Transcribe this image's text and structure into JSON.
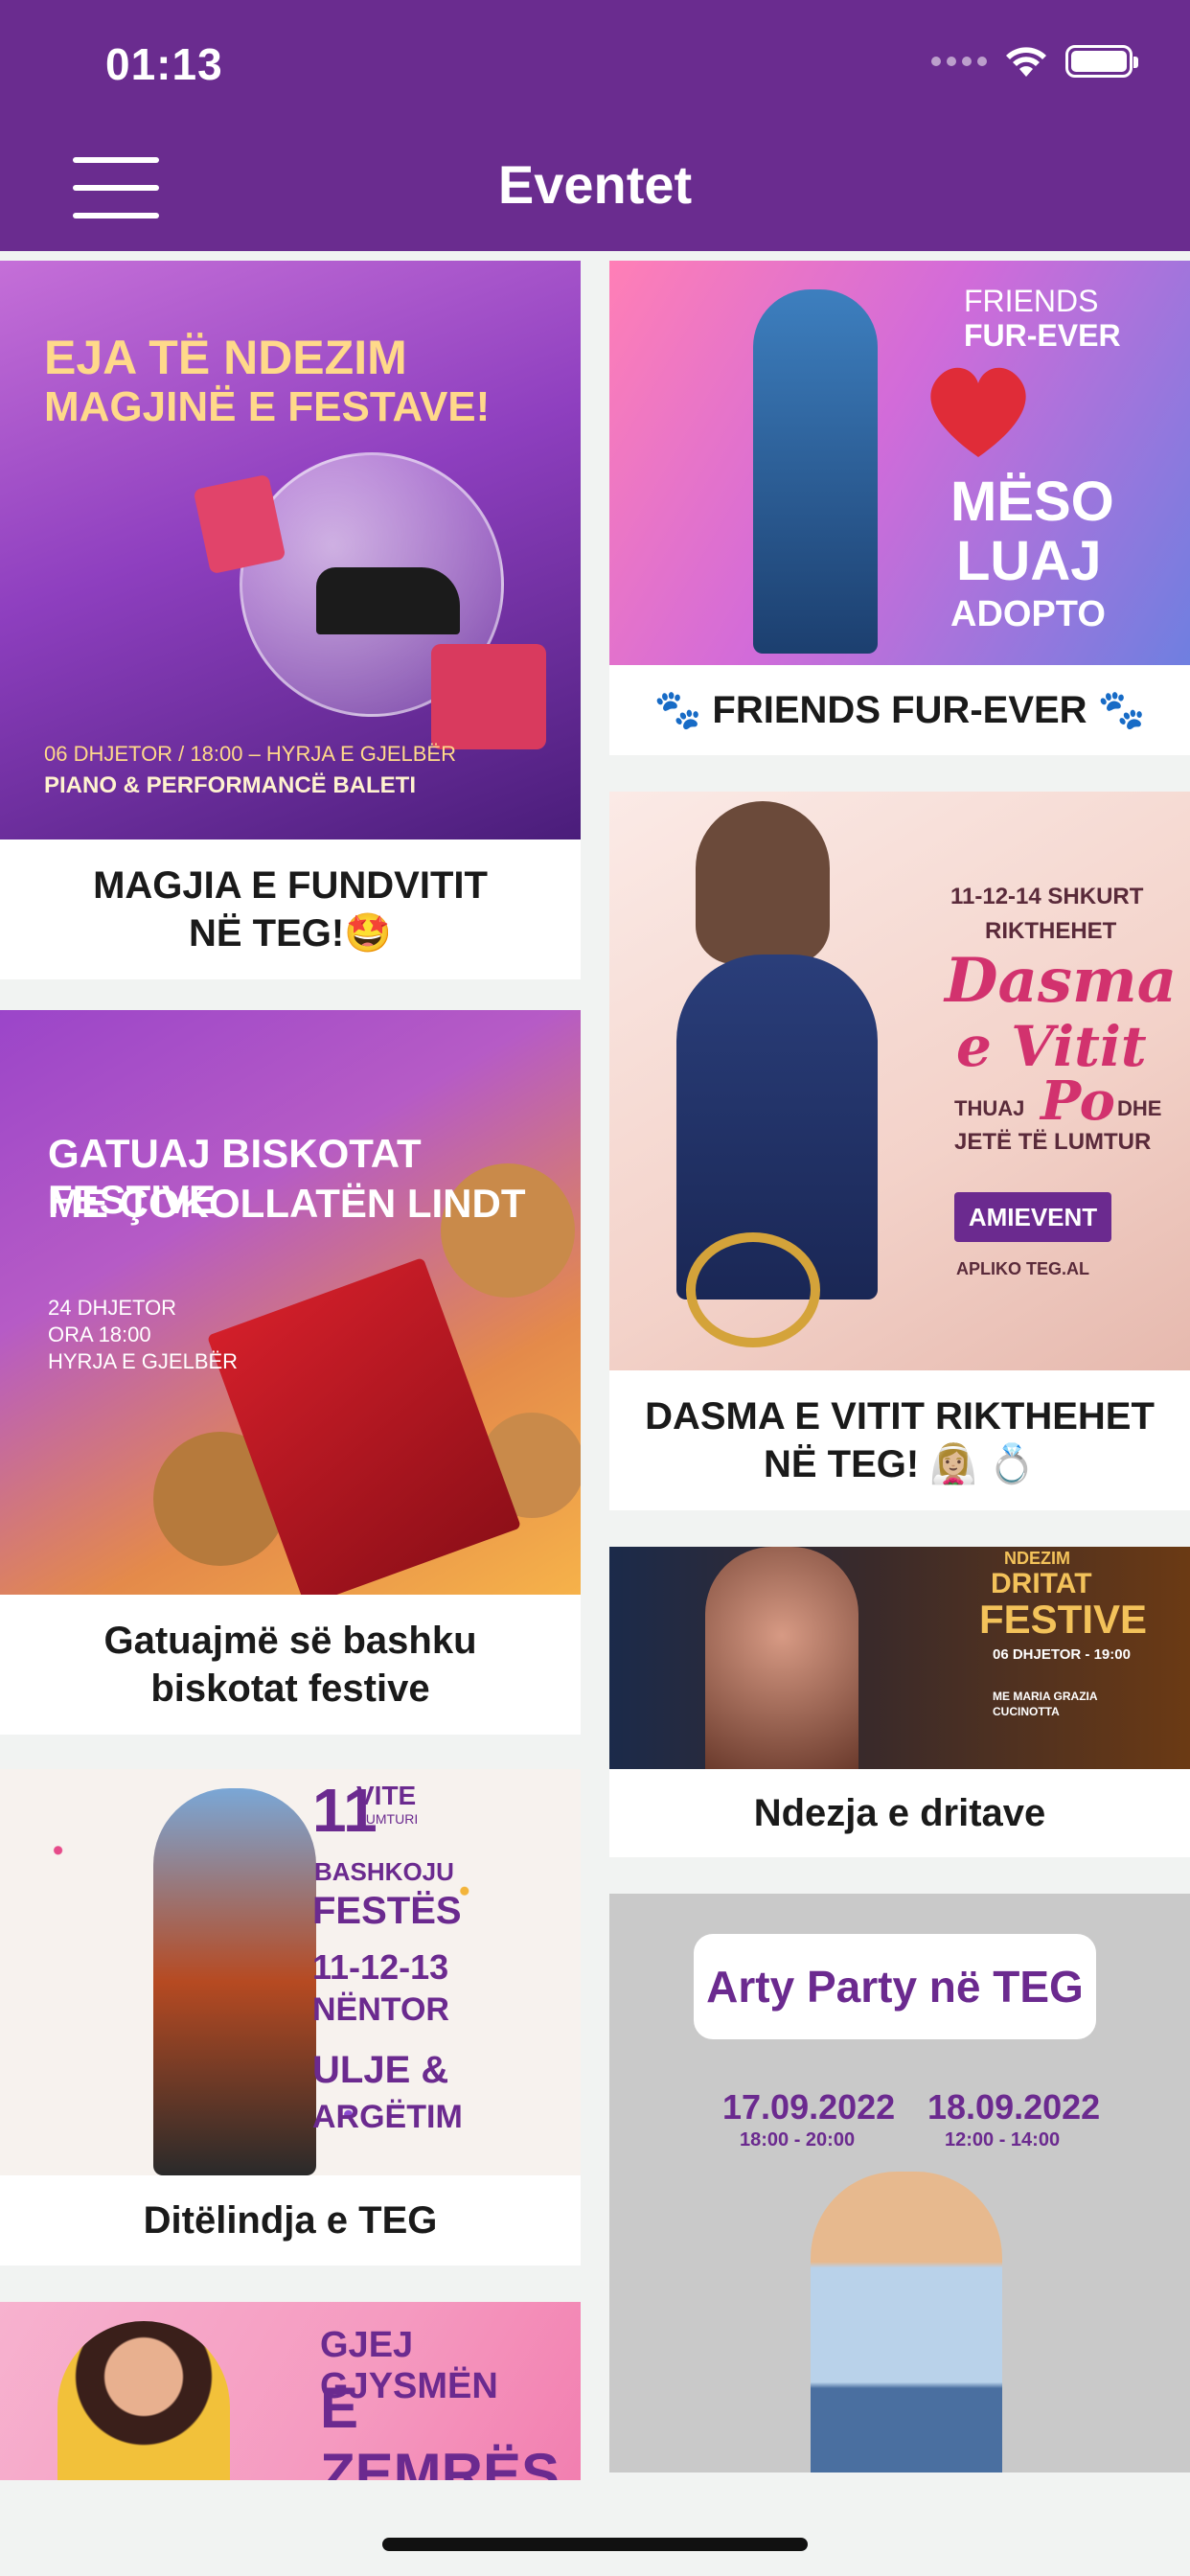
{
  "status": {
    "time": "01:13"
  },
  "header": {
    "title": "Eventet"
  },
  "colors": {
    "header_bg": "#6a2c8f",
    "page_bg": "#f1f3f2"
  },
  "events": [
    {
      "caption": "MAGJIA E FUNDVITIT\nNË TEG!🤩",
      "poster_text": [
        "EJA TË NDEZIM",
        "MAGJINË E FESTAVE!",
        "06 DHJETOR / 18:00 – HYRJA E GJELBËR",
        "PIANO & PERFORMANCË BALETI"
      ]
    },
    {
      "caption": "🐾 FRIENDS FUR-EVER 🐾",
      "poster_text": [
        "FRIENDS",
        "FUR-EVER",
        "MËSO",
        "LUAJ",
        "ADOPTO"
      ]
    },
    {
      "caption": "DASMA E VITIT RIKTHEHET\nNË TEG! 👰🏼‍♀️ 💍",
      "poster_text": [
        "11-12-14 SHKURT",
        "RIKTHEHET",
        "Dasma",
        "e Vitit",
        "THUAJ",
        "Po",
        "DHE",
        "JETË TË LUMTUR",
        "AMIEVENT",
        "APLIKO TEG.AL"
      ]
    },
    {
      "caption": "Gatuajmë së bashku\nbiskotat festive",
      "poster_text": [
        "GATUAJ BISKOTAT FESTIVE",
        "ME ÇOKOLLATËN LINDT",
        "24 DHJETOR",
        "ORA 18:00",
        "HYRJA E GJELBËR"
      ]
    },
    {
      "caption": "Ndezja e dritave",
      "poster_text": [
        "NDEZIM",
        "DRITAT",
        "FESTIVE",
        "06 DHJETOR - 19:00",
        "ME MARIA GRAZIA CUCINOTTA"
      ]
    },
    {
      "caption": "Ditëlindja e TEG",
      "poster_text": [
        "11",
        "VITE",
        "LUMTURI",
        "BASHKOJU",
        "FESTËS",
        "11-12-13",
        "NËNTOR",
        "ULJE &",
        "ARGËTIM"
      ]
    },
    {
      "caption": "",
      "poster_text": [
        "Arty Party në TEG",
        "17.09.2022",
        "18:00 - 20:00",
        "18.09.2022",
        "12:00 - 14:00"
      ]
    },
    {
      "caption": "",
      "poster_text": [
        "GJEJ GJYSMËN",
        "E ZEMRËS"
      ]
    }
  ]
}
